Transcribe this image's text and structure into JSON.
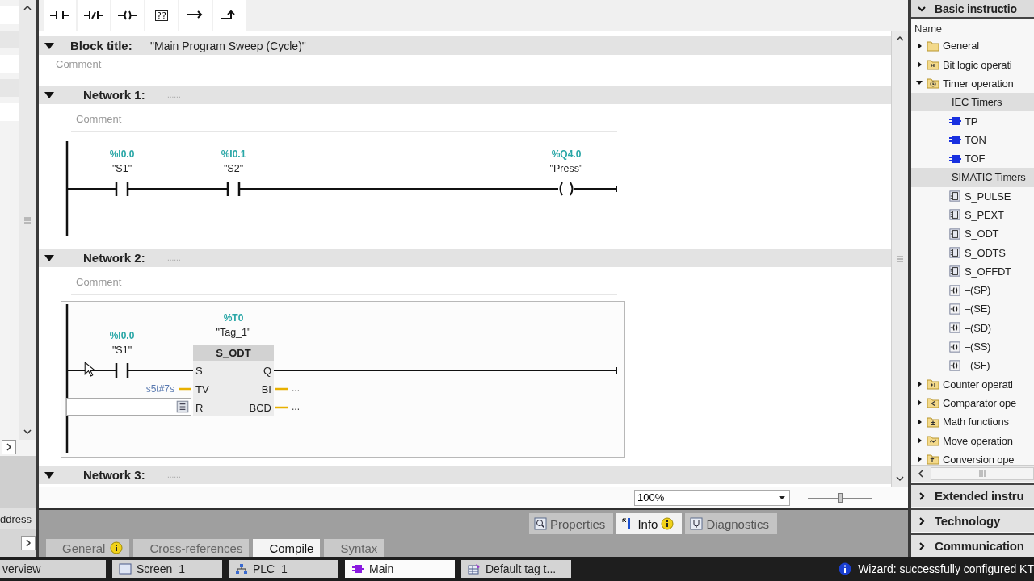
{
  "toolbar": [
    {
      "kind": "no-contact"
    },
    {
      "kind": "nc-contact"
    },
    {
      "kind": "coil"
    },
    {
      "kind": "empty-box",
      "label": "??"
    },
    {
      "kind": "open-branch"
    },
    {
      "kind": "close-branch"
    }
  ],
  "left_panel": {
    "column_header": "ddress"
  },
  "block": {
    "label": "Block title:",
    "title": "\"Main Program Sweep (Cycle)\"",
    "comment": "Comment",
    "expanded": true
  },
  "networks": [
    {
      "label": "Network 1:",
      "title": "......",
      "expanded": true,
      "selected": false,
      "comment": "Comment",
      "elements": [
        {
          "kind": "contact",
          "address": "%I0.0",
          "tag": "\"S1\""
        },
        {
          "kind": "contact",
          "address": "%I0.1",
          "tag": "\"S2\""
        },
        {
          "kind": "coil",
          "address": "%Q4.0",
          "tag": "\"Press\""
        }
      ]
    },
    {
      "label": "Network 2:",
      "title": "......",
      "expanded": true,
      "selected": true,
      "comment": "Comment",
      "elements": [
        {
          "kind": "contact",
          "address": "%I0.0",
          "tag": "\"S1\""
        },
        {
          "kind": "timer",
          "address": "%T0",
          "tag": "\"Tag_1\"",
          "name": "S_ODT",
          "inputs": [
            {
              "name": "S"
            },
            {
              "name": "TV",
              "value": "s5t#7s"
            },
            {
              "name": "R",
              "editing": true
            }
          ],
          "outputs": [
            {
              "name": "Q"
            },
            {
              "name": "BI",
              "value": "..."
            },
            {
              "name": "BCD",
              "value": "..."
            }
          ]
        }
      ]
    },
    {
      "label": "Network 3:",
      "title": "......",
      "expanded": true
    }
  ],
  "zoom": {
    "value": "100%",
    "level": 0.5
  },
  "inspector": {
    "tabs": [
      {
        "label": "Properties",
        "kind": "properties",
        "selected": false,
        "badge": false
      },
      {
        "label": "Info",
        "kind": "info",
        "selected": true,
        "badge": true
      },
      {
        "label": "Diagnostics",
        "kind": "diagnostics",
        "selected": false,
        "badge": false
      }
    ],
    "subtabs": [
      {
        "label": "General",
        "selected": false,
        "warning": true
      },
      {
        "label": "Cross-references",
        "selected": false,
        "warning": false
      },
      {
        "label": "Compile",
        "selected": true,
        "warning": false
      },
      {
        "label": "Syntax",
        "selected": false,
        "warning": false
      }
    ]
  },
  "instructions": {
    "title": "Basic instructio",
    "expanded": true,
    "column": "Name",
    "tree": [
      {
        "label": "General",
        "kind": "folder",
        "expanded": false
      },
      {
        "label": "Bit logic operati",
        "kind": "bit-folder",
        "expanded": false
      },
      {
        "label": "Timer operation",
        "kind": "timer-folder",
        "expanded": true,
        "children": [
          {
            "label": "IEC Timers",
            "kind": "group",
            "children": [
              {
                "label": "TP",
                "kind": "iec"
              },
              {
                "label": "TON",
                "kind": "iec"
              },
              {
                "label": "TOF",
                "kind": "iec"
              }
            ]
          },
          {
            "label": "SIMATIC Timers",
            "kind": "group",
            "children": [
              {
                "label": "S_PULSE",
                "kind": "box"
              },
              {
                "label": "S_PEXT",
                "kind": "box"
              },
              {
                "label": "S_ODT",
                "kind": "box"
              },
              {
                "label": "S_ODTS",
                "kind": "box"
              },
              {
                "label": "S_OFFDT",
                "kind": "box"
              },
              {
                "label": "–(SP)",
                "kind": "coil"
              },
              {
                "label": "–(SE)",
                "kind": "coil"
              },
              {
                "label": "–(SD)",
                "kind": "coil"
              },
              {
                "label": "–(SS)",
                "kind": "coil"
              },
              {
                "label": "–(SF)",
                "kind": "coil"
              }
            ]
          }
        ]
      },
      {
        "label": "Counter operati",
        "kind": "counter-folder",
        "expanded": false
      },
      {
        "label": "Comparator ope",
        "kind": "compare-folder",
        "expanded": false
      },
      {
        "label": "Math functions",
        "kind": "math-folder",
        "expanded": false
      },
      {
        "label": "Move operation",
        "kind": "move-folder",
        "expanded": false
      },
      {
        "label": "Conversion ope",
        "kind": "convert-folder",
        "expanded": false
      }
    ],
    "sections": [
      {
        "label": "Extended instru",
        "expanded": false
      },
      {
        "label": "Technology",
        "expanded": false
      },
      {
        "label": "Communication",
        "expanded": false
      }
    ]
  },
  "taskbar": {
    "items": [
      {
        "label": "verview",
        "kind": "none",
        "selected": false
      },
      {
        "label": "Screen_1",
        "kind": "screen",
        "selected": false
      },
      {
        "label": "PLC_1",
        "kind": "plc",
        "selected": false
      },
      {
        "label": "Main",
        "kind": "block",
        "selected": true
      },
      {
        "label": "Default tag t...",
        "kind": "tags",
        "selected": false
      }
    ],
    "status": "Wizard: successfully configured KT"
  }
}
